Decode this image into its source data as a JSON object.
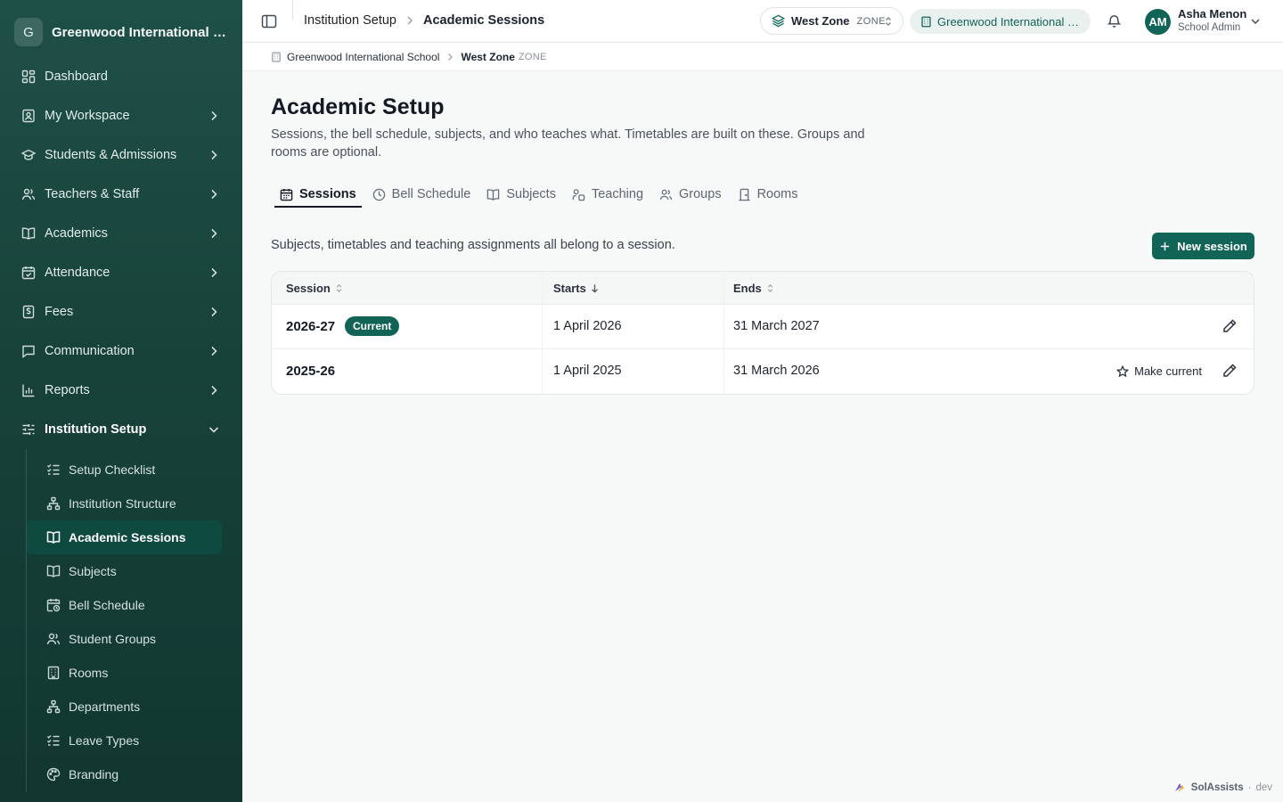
{
  "sidebar": {
    "brand_initial": "G",
    "brand_name": "Greenwood International School",
    "items": [
      {
        "label": "Dashboard",
        "icon": "dashboard-icon"
      },
      {
        "label": "My Workspace",
        "icon": "workspace-icon"
      },
      {
        "label": "Students & Admissions",
        "icon": "graduation-cap-icon"
      },
      {
        "label": "Teachers & Staff",
        "icon": "users-icon"
      },
      {
        "label": "Academics",
        "icon": "book-icon"
      },
      {
        "label": "Attendance",
        "icon": "calendar-check-icon"
      },
      {
        "label": "Fees",
        "icon": "receipt-icon"
      },
      {
        "label": "Communication",
        "icon": "message-icon"
      },
      {
        "label": "Reports",
        "icon": "bar-chart-icon"
      },
      {
        "label": "Institution Setup",
        "icon": "sliders-icon"
      }
    ],
    "setup_items": [
      {
        "label": "Setup Checklist",
        "icon": "checklist-icon"
      },
      {
        "label": "Institution Structure",
        "icon": "hierarchy-icon"
      },
      {
        "label": "Academic Sessions",
        "icon": "book-open-icon"
      },
      {
        "label": "Subjects",
        "icon": "book-open-icon"
      },
      {
        "label": "Bell Schedule",
        "icon": "calendar-clock-icon"
      },
      {
        "label": "Student Groups",
        "icon": "users-icon"
      },
      {
        "label": "Rooms",
        "icon": "building-icon"
      },
      {
        "label": "Departments",
        "icon": "hierarchy-icon"
      },
      {
        "label": "Leave Types",
        "icon": "checklist-icon"
      },
      {
        "label": "Branding",
        "icon": "palette-icon"
      }
    ]
  },
  "topbar": {
    "crumb1": "Institution Setup",
    "crumb2": "Academic Sessions",
    "zone_name": "West Zone",
    "zone_tag": "ZONE",
    "school_name": "Greenwood International School",
    "user_initials": "AM",
    "user_name": "Asha Menon",
    "user_role": "School Admin"
  },
  "subbar": {
    "school": "Greenwood International School",
    "zone": "West Zone",
    "zone_tag": "ZONE"
  },
  "page": {
    "title": "Academic Setup",
    "description": "Sessions, the bell schedule, subjects, and who teaches what. Timetables are built on these. Groups and rooms are optional.",
    "tabs": [
      {
        "label": "Sessions",
        "icon": "calendar-icon"
      },
      {
        "label": "Bell Schedule",
        "icon": "clock-icon"
      },
      {
        "label": "Subjects",
        "icon": "book-open-icon"
      },
      {
        "label": "Teaching",
        "icon": "teaching-icon"
      },
      {
        "label": "Groups",
        "icon": "users-icon"
      },
      {
        "label": "Rooms",
        "icon": "door-icon"
      }
    ],
    "intro": "Subjects, timetables and teaching assignments all belong to a session.",
    "new_button": "New session"
  },
  "table": {
    "headers": {
      "session": "Session",
      "starts": "Starts",
      "ends": "Ends"
    },
    "rows": [
      {
        "session": "2026-27",
        "badge": "Current",
        "starts": "1 April 2026",
        "ends": "31 March 2027",
        "action": ""
      },
      {
        "session": "2025-26",
        "badge": "",
        "starts": "1 April 2025",
        "ends": "31 March 2026",
        "action": "Make current"
      }
    ]
  },
  "footer": {
    "brand": "SolAssists",
    "env": "dev"
  },
  "colors": {
    "sidebar": "#174239",
    "accent": "#116456",
    "accent_light": "#e9f1ef"
  }
}
